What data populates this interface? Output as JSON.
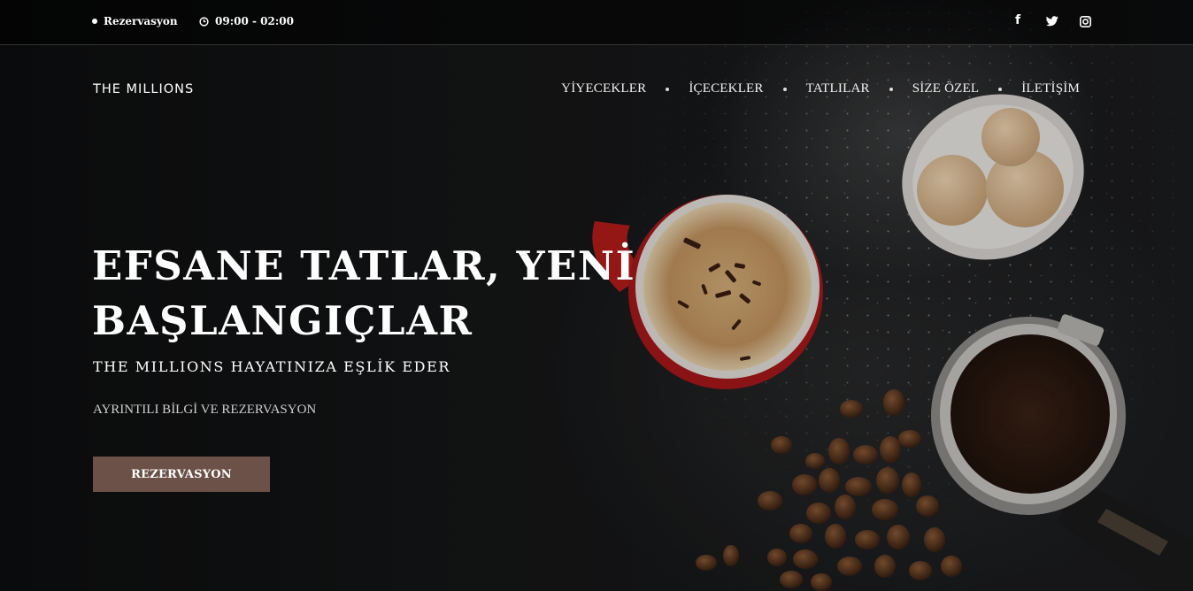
{
  "topbar": {
    "reservation_label": "Rezervasyon",
    "hours": "09:00 - 02:00",
    "social": [
      {
        "icon": "facebook-icon",
        "glyph": "f"
      },
      {
        "icon": "twitter-icon",
        "glyph": "t"
      },
      {
        "icon": "instagram-icon",
        "glyph": "◎"
      }
    ]
  },
  "header": {
    "brand": "THE MILLIONS",
    "nav": [
      "YİYECEKLER",
      "İÇECEKLER",
      "TATLILAR",
      "SİZE ÖZEL",
      "İLETİŞİM"
    ]
  },
  "hero": {
    "headline_line1": "EFSANE TATLAR, YENİ",
    "headline_line2": "BAŞLANGIÇLAR",
    "subheading": "THE MILLIONS HAYATINIZA EŞLİK EDER",
    "info": "AYRINTILI BİLGİ VE REZERVASYON",
    "cta_label": "REZERVASYON"
  },
  "colors": {
    "background": "#111213",
    "cta": "#6b5147",
    "cup_red": "#c0201c",
    "coffee_foam": "#c8a06a"
  }
}
